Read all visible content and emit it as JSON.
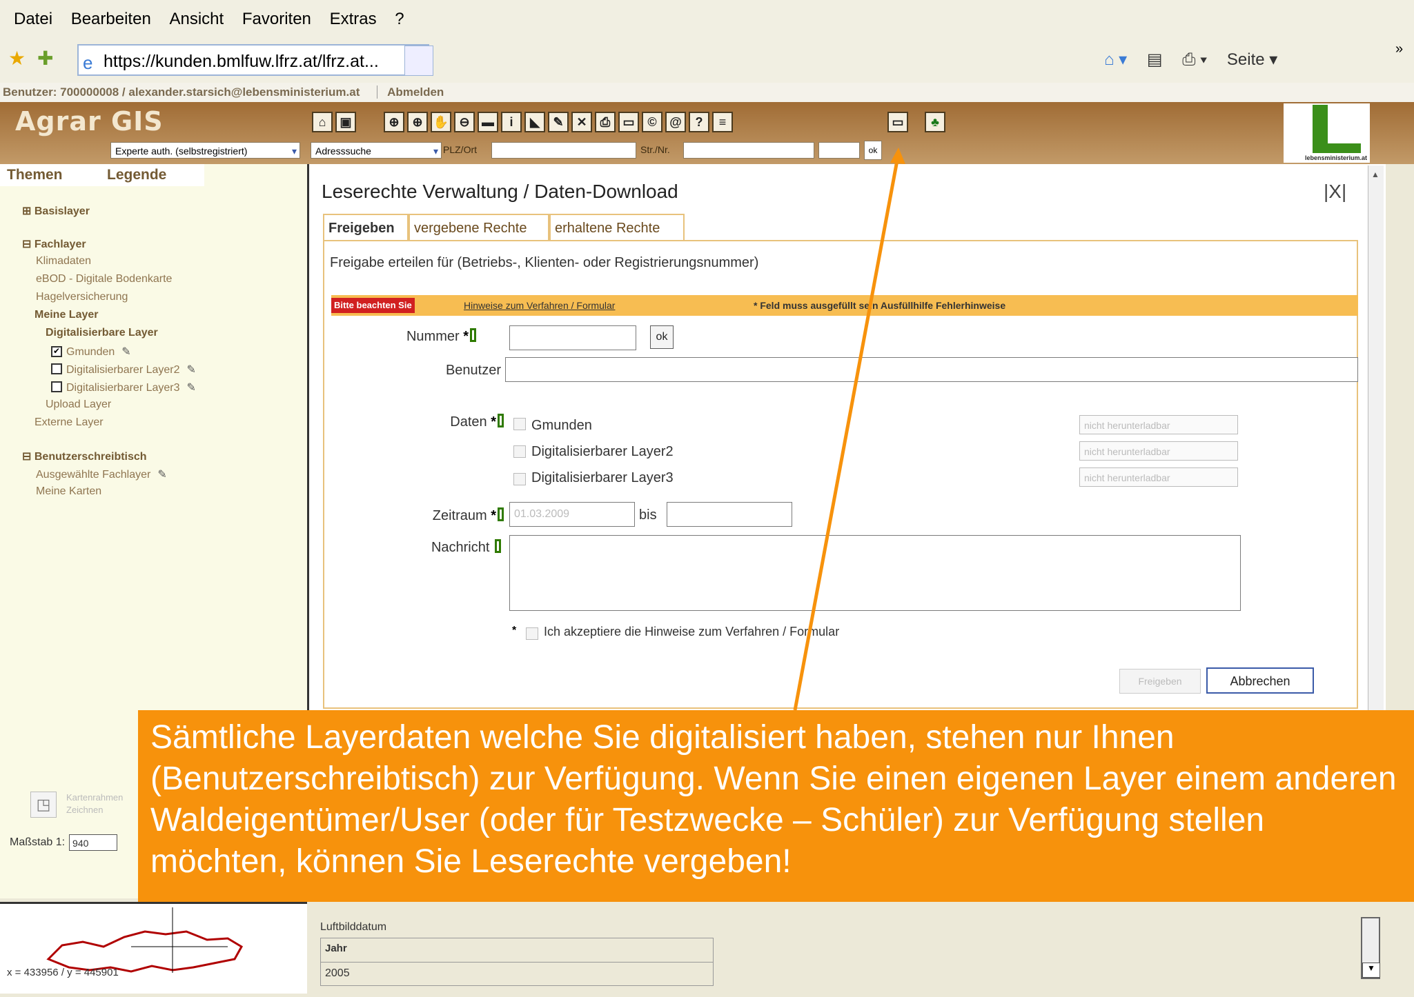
{
  "menu": [
    "Datei",
    "Bearbeiten",
    "Ansicht",
    "Favoriten",
    "Extras",
    "?"
  ],
  "browser": {
    "address": "https://kunden.bmlfuw.lfrz.at/lfrz.at...",
    "right_buttons": [
      "Seite ▾"
    ],
    "chevron": "»"
  },
  "userbar": {
    "user": "Benutzer: 700000008 / alexander.starsich@lebensministerium.at",
    "logout": "Abmelden"
  },
  "app": {
    "title": "Agrar GIS",
    "role_select": "Experte auth. (selbstregistriert)",
    "search_select": "Adresssuche",
    "plz_label": "PLZ/Ort",
    "street_label": "Str./Nr.",
    "go_label": "ok",
    "logo_text": "lebensministerium.at",
    "toolbar_icons": [
      "home-icon",
      "save-icon",
      "zoom-extent-icon",
      "zoom-in-icon",
      "pan-icon",
      "zoom-out-icon",
      "measure-icon",
      "info-icon",
      "select-icon",
      "edit-icon",
      "delete-icon",
      "print-icon",
      "photo-icon",
      "copyright-icon",
      "at-icon",
      "help-icon",
      "legend-icon"
    ]
  },
  "left": {
    "tabs": [
      "Themen",
      "Legende"
    ],
    "tree": [
      {
        "text": "Basislayer",
        "prefix": "⊞",
        "bold": true
      },
      {
        "text": "Fachlayer",
        "prefix": "⊟",
        "bold": true
      },
      {
        "text": "Klimadaten"
      },
      {
        "text": "eBOD - Digitale Bodenkarte"
      },
      {
        "text": "Hagelversicherung"
      },
      {
        "text": "Meine Layer",
        "bold": true
      },
      {
        "text": "Digitalisierbare Layer",
        "bold": true
      },
      {
        "text": "Gmunden",
        "checkbox": true,
        "checked": true
      },
      {
        "text": "Digitalisierbarer Layer2",
        "checkbox": true
      },
      {
        "text": "Digitalisierbarer Layer3",
        "checkbox": true
      },
      {
        "text": "Upload Layer"
      },
      {
        "text": "Externe Layer"
      },
      {
        "text": "Benutzerschreibtisch",
        "prefix": "⊟",
        "bold": true
      },
      {
        "text": "Ausgewählte Fachlayer"
      },
      {
        "text": "Meine Karten"
      }
    ],
    "massstab_label": "Maßstab 1:",
    "massstab_value": "940",
    "coords": "x = 433956 / y = 445901",
    "collapsed_labels": [
      "Kartenrahmen",
      "Zeichnen"
    ]
  },
  "dialog": {
    "title": "Leserechte Verwaltung / Daten-Download",
    "close": "|X|",
    "tabs": [
      "Freigeben",
      "vergebene Rechte",
      "erhaltene Rechte"
    ],
    "subtitle": "Freigabe erteilen für (Betriebs-, Klienten- oder Registrierungsnummer)",
    "hint_red": "Bitte beachten Sie",
    "hint_link": "Hinweise zum Verfahren / Formular",
    "hint_legend": "* Feld muss ausgefüllt sein  Ausfüllhilfe  Fehlerhinweise",
    "nummer_label": "Nummer",
    "ok_label": "ok",
    "benutzer_label": "Benutzer",
    "daten_label": "Daten",
    "daten_items": [
      "Gmunden",
      "Digitalisierbarer Layer2",
      "Digitalisierbarer Layer3"
    ],
    "daten_select": "nicht herunterladbar",
    "zeitraum_label": "Zeitraum",
    "zeitraum_from": "01.03.2009",
    "bis_label": "bis",
    "nachricht_label": "Nachricht",
    "accept_label": "Ich akzeptiere die Hinweise zum Verfahren / Formular",
    "submit_label": "Freigeben",
    "cancel_label": "Abbrechen"
  },
  "bottom": {
    "luft_label": "Luftbilddatum",
    "luft_header": "Jahr",
    "luft_value": "2005"
  },
  "callout": {
    "text": "Sämtliche Layerdaten welche Sie digitalisiert haben, stehen nur Ihnen (Benutzerschreibtisch) zur Verfügung. Wenn Sie einen eigenen Layer einem anderen Waldeigentümer/User (oder für Testzwecke – Schüler) zur Verfügung stellen möchten, können Sie Leserechte vergeben!",
    "color": "#f7920c"
  },
  "colors": {
    "header_brown": "#a06c35",
    "tab_border": "#e8c27c",
    "hint_bar": "#f7bd52",
    "error_red": "#d12020",
    "help_green": "#2f7a00"
  }
}
